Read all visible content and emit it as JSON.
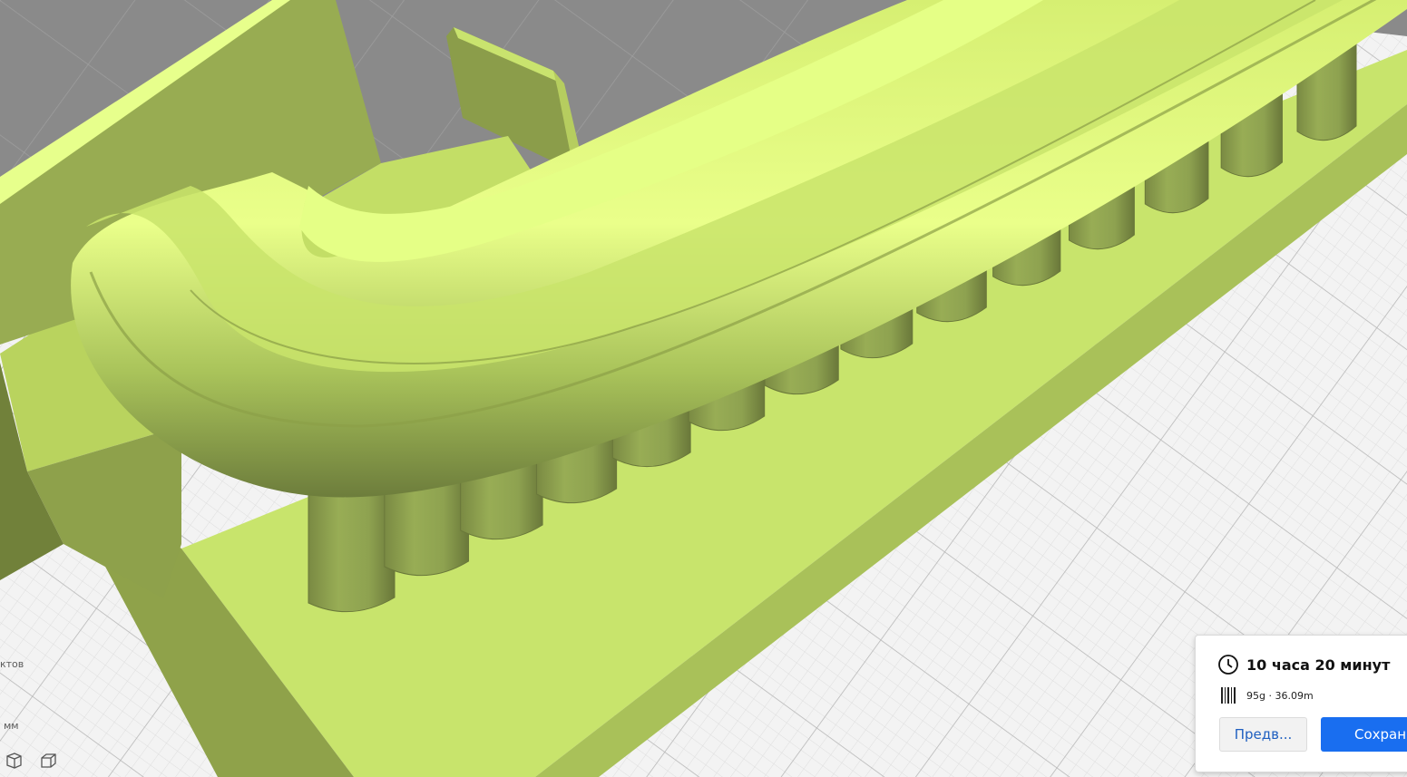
{
  "viewport": {
    "plate_color": "#f3f3f3",
    "outside_color": "#8a8a8a",
    "model_color": "#c6e36a",
    "model_highlight": "#eaff8a",
    "model_shadow": "#7e8f45"
  },
  "sidebar": {
    "objects_label_fragment": "ктов",
    "unit_label_fragment": "мм",
    "view_icons": [
      "3d-view-icon",
      "front-view-icon"
    ]
  },
  "print_panel": {
    "time": "10 часа 20 минут",
    "material": "95g · 36.09m",
    "preview_button": "Предв...",
    "save_button": "Сохран",
    "accent": "#196ef0"
  }
}
